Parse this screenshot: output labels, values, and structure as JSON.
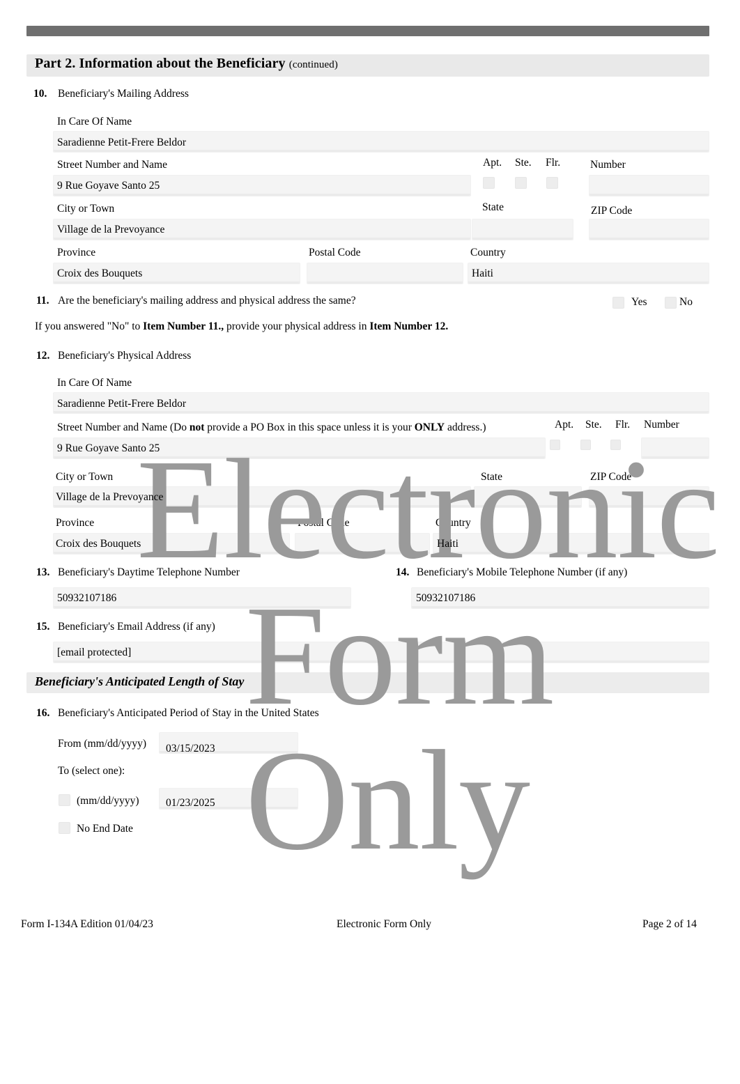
{
  "document": {
    "part_title": "Part 2.  Information about the Beneficiary",
    "part_title_suffix": "(continued)",
    "section_stay_title": "Beneficiary's Anticipated Length of Stay",
    "watermark": {
      "line1": "Electronic",
      "line2": "Form",
      "line3": "Only",
      "color": "#9a9a9a"
    }
  },
  "item10": {
    "number": "10.",
    "title": "Beneficiary's Mailing Address",
    "labels": {
      "in_care_of": "In Care Of Name",
      "street": "Street Number and Name",
      "apt": "Apt.",
      "ste": "Ste.",
      "flr": "Flr.",
      "number": "Number",
      "city": "City or Town",
      "state": "State",
      "zip": "ZIP Code",
      "province": "Province",
      "postal_code": "Postal Code",
      "country": "Country"
    },
    "values": {
      "in_care_of": "Saradienne Petit-Frere Beldor",
      "street": "9 Rue Goyave Santo 25",
      "number": "",
      "city": "Village de la Prevoyance",
      "state": "",
      "zip": "",
      "province": "Croix des Bouquets",
      "postal_code": "",
      "country": "Haiti"
    }
  },
  "item11": {
    "number": "11.",
    "question": "Are the beneficiary's mailing address and physical address the same?",
    "option_yes": "Yes",
    "option_no": "No",
    "note_part1": "If you answered \"No\" to ",
    "note_bold1": "Item Number 11.,",
    "note_part2": " provide your physical address in ",
    "note_bold2": "Item Number 12."
  },
  "item12": {
    "number": "12.",
    "title": "Beneficiary's Physical Address",
    "labels": {
      "in_care_of": "In Care Of Name",
      "street_pre": "Street Number and Name (Do ",
      "street_bold1": "not",
      "street_mid": " provide a PO Box in this space unless it is your ",
      "street_bold2": "ONLY",
      "street_post": " address.)",
      "apt": "Apt.",
      "ste": "Ste.",
      "flr": "Flr.",
      "number": "Number",
      "city": "City or Town",
      "state": "State",
      "zip": "ZIP Code",
      "province": "Province",
      "postal_code": "Postal Code",
      "country": "Country"
    },
    "values": {
      "in_care_of": "Saradienne Petit-Frere Beldor",
      "street": "9 Rue Goyave Santo 25",
      "number": "",
      "city": "Village de la Prevoyance",
      "state": "",
      "zip": "",
      "province": "Croix des Bouquets",
      "postal_code": "",
      "country": "Haiti"
    }
  },
  "item13": {
    "number": "13.",
    "label": "Beneficiary's Daytime Telephone Number",
    "value": "50932107186"
  },
  "item14": {
    "number": "14.",
    "label": "Beneficiary's Mobile Telephone Number (if any)",
    "value": "50932107186"
  },
  "item15": {
    "number": "15.",
    "label": "Beneficiary's Email Address (if any)",
    "value": "[email protected]"
  },
  "item16": {
    "number": "16.",
    "title": "Beneficiary's Anticipated Period of Stay in the United States",
    "from_label": "From (mm/dd/yyyy)",
    "from_value": "03/15/2023",
    "to_label": "To (select one):",
    "to_date_label": "(mm/dd/yyyy)",
    "to_date_value": "01/23/2025",
    "no_end_date_label": "No End Date"
  },
  "footer": {
    "left": "Form I-134A   Edition   01/04/23",
    "center": "Electronic Form Only",
    "right": "Page 2 of 14"
  }
}
